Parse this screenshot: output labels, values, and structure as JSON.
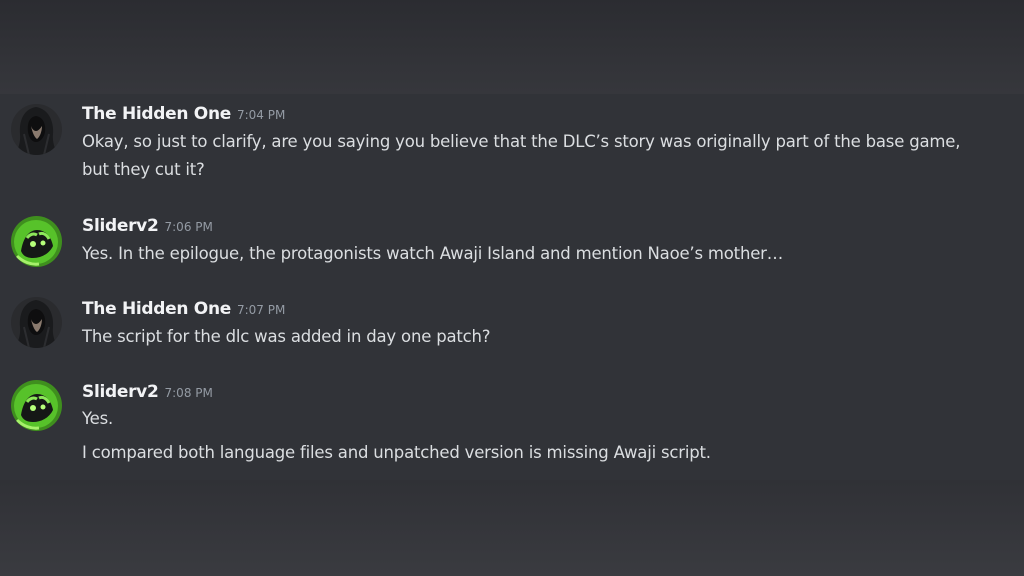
{
  "messages": [
    {
      "author": "The Hidden One",
      "time": "7:04 PM",
      "avatar_icon": "hooded-figure-avatar",
      "lines": [
        "Okay, so just to clarify, are you saying you believe that the DLC’s story was originally part of the base game,",
        "but they cut it?"
      ]
    },
    {
      "author": "Sliderv2",
      "time": "7:06 PM",
      "avatar_icon": "green-creature-avatar",
      "lines": [
        "Yes. In the epilogue, the protagonists watch Awaji Island and mention Naoe’s mother…"
      ]
    },
    {
      "author": "The Hidden One",
      "time": "7:07 PM",
      "avatar_icon": "hooded-figure-avatar",
      "lines": [
        "The script for the dlc was added in day one patch?"
      ]
    },
    {
      "author": "Sliderv2",
      "time": "7:08 PM",
      "avatar_icon": "green-creature-avatar",
      "lines": [
        "Yes.",
        "I compared both language files and unpatched version is missing Awaji script."
      ]
    }
  ],
  "colors": {
    "background": "#313338",
    "username": "#f2f3f5",
    "timestamp": "#949ba4",
    "message_text": "#dbdee1",
    "accent_green": "#57c22a"
  }
}
